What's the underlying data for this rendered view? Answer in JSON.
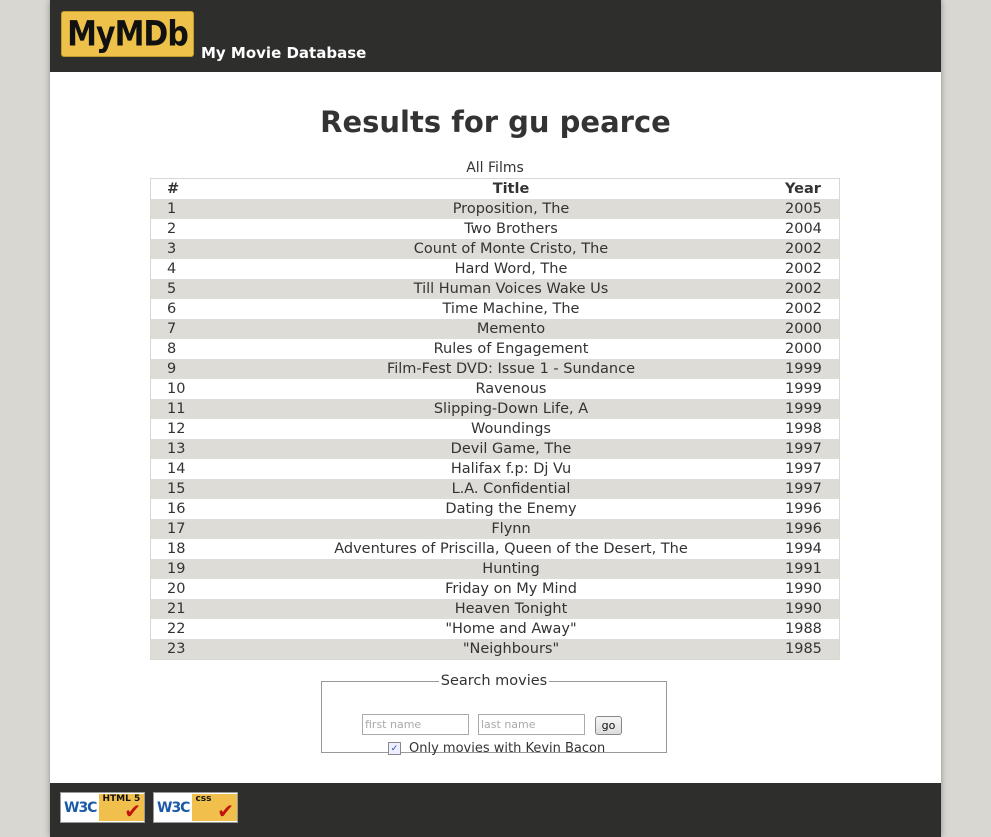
{
  "header": {
    "logo_text": "MyMDb",
    "site_title": "My Movie Database"
  },
  "main": {
    "heading": "Results for gu pearce",
    "table": {
      "caption": "All Films",
      "columns": [
        "#",
        "Title",
        "Year"
      ],
      "rows": [
        {
          "num": "1",
          "title": "Proposition, The",
          "year": "2005"
        },
        {
          "num": "2",
          "title": "Two Brothers",
          "year": "2004"
        },
        {
          "num": "3",
          "title": "Count of Monte Cristo, The",
          "year": "2002"
        },
        {
          "num": "4",
          "title": "Hard Word, The",
          "year": "2002"
        },
        {
          "num": "5",
          "title": "Till Human Voices Wake Us",
          "year": "2002"
        },
        {
          "num": "6",
          "title": "Time Machine, The",
          "year": "2002"
        },
        {
          "num": "7",
          "title": "Memento",
          "year": "2000"
        },
        {
          "num": "8",
          "title": "Rules of Engagement",
          "year": "2000"
        },
        {
          "num": "9",
          "title": "Film-Fest DVD: Issue 1 - Sundance",
          "year": "1999"
        },
        {
          "num": "10",
          "title": "Ravenous",
          "year": "1999"
        },
        {
          "num": "11",
          "title": "Slipping-Down Life, A",
          "year": "1999"
        },
        {
          "num": "12",
          "title": "Woundings",
          "year": "1998"
        },
        {
          "num": "13",
          "title": "Devil Game, The",
          "year": "1997"
        },
        {
          "num": "14",
          "title": "Halifax f.p: Dj Vu",
          "year": "1997"
        },
        {
          "num": "15",
          "title": "L.A. Confidential",
          "year": "1997"
        },
        {
          "num": "16",
          "title": "Dating the Enemy",
          "year": "1996"
        },
        {
          "num": "17",
          "title": "Flynn",
          "year": "1996"
        },
        {
          "num": "18",
          "title": "Adventures of Priscilla, Queen of the Desert, The",
          "year": "1994"
        },
        {
          "num": "19",
          "title": "Hunting",
          "year": "1991"
        },
        {
          "num": "20",
          "title": "Friday on My Mind",
          "year": "1990"
        },
        {
          "num": "21",
          "title": "Heaven Tonight",
          "year": "1990"
        },
        {
          "num": "22",
          "title": "\"Home and Away\"",
          "year": "1988"
        },
        {
          "num": "23",
          "title": "\"Neighbours\"",
          "year": "1985"
        }
      ]
    }
  },
  "search": {
    "legend": "Search movies",
    "first_name_placeholder": "first name",
    "last_name_placeholder": "last name",
    "go_label": "go",
    "bacon_label": "Only movies with Kevin Bacon",
    "bacon_checked": true
  },
  "footer": {
    "badges": [
      {
        "logo": "W3C",
        "kind": "HTML 5"
      },
      {
        "logo": "W3C",
        "kind": "css"
      }
    ]
  },
  "colors": {
    "banner": "#2e2e2c",
    "logo_bg": "#eec14a",
    "row_stripe": "#dddcd6",
    "page_bg": "#d8d7d1"
  }
}
